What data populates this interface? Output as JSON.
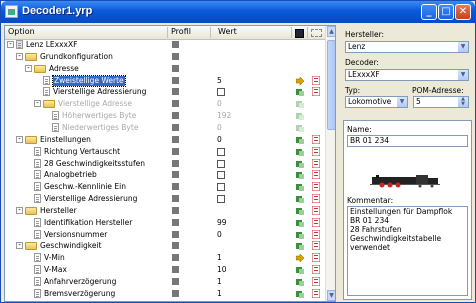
{
  "window": {
    "title": "Decoder1.yrp"
  },
  "grid": {
    "columns": {
      "option": "Option",
      "profil": "Profil",
      "wert": "Wert"
    },
    "rows": [
      {
        "indent": 0,
        "icon": "root",
        "label": "Lenz LExxxXF",
        "profil": true,
        "toggle": "-"
      },
      {
        "indent": 1,
        "icon": "folder",
        "label": "Grundkonfiguration",
        "profil": true,
        "toggle": "-"
      },
      {
        "indent": 2,
        "icon": "folder",
        "label": "Adresse",
        "profil": true,
        "toggle": "-"
      },
      {
        "indent": 3,
        "icon": "doc",
        "label": "Zweistellige Werte",
        "profil": true,
        "value": "5",
        "sel": true,
        "act": "arrow"
      },
      {
        "indent": 3,
        "icon": "doc",
        "label": "Vierstellige Adressierung",
        "profil": true,
        "check": true
      },
      {
        "indent": 3,
        "icon": "folder",
        "label": "Vierstellige Adresse",
        "profil": true,
        "value": "0",
        "dis": true,
        "toggle": "-"
      },
      {
        "indent": 4,
        "icon": "doc",
        "label": "Höherwertiges Byte",
        "profil": true,
        "value": "192",
        "dis": true
      },
      {
        "indent": 4,
        "icon": "doc",
        "label": "Niederwertiges Byte",
        "profil": true,
        "value": "0",
        "dis": true
      },
      {
        "indent": 1,
        "icon": "folder",
        "label": "Einstellungen",
        "profil": true,
        "value": "0",
        "toggle": "-"
      },
      {
        "indent": 2,
        "icon": "doc",
        "label": "Richtung Vertauscht",
        "profil": true,
        "check": true
      },
      {
        "indent": 2,
        "icon": "doc",
        "label": "28 Geschwindigkeitsstufen",
        "profil": true,
        "check": true
      },
      {
        "indent": 2,
        "icon": "doc",
        "label": "Analogbetrieb",
        "profil": true,
        "check": true
      },
      {
        "indent": 2,
        "icon": "doc",
        "label": "Geschw.-Kennlinie Ein",
        "profil": true,
        "check": true
      },
      {
        "indent": 2,
        "icon": "doc",
        "label": "Vierstellige Adressierung",
        "profil": true,
        "check": true
      },
      {
        "indent": 1,
        "icon": "folder",
        "label": "Hersteller",
        "profil": true,
        "toggle": "-"
      },
      {
        "indent": 2,
        "icon": "doc",
        "label": "Identifikation Hersteller",
        "profil": true,
        "value": "99"
      },
      {
        "indent": 2,
        "icon": "doc",
        "label": "Versionsnummer",
        "profil": true,
        "value": "0"
      },
      {
        "indent": 1,
        "icon": "folder",
        "label": "Geschwindigkeit",
        "profil": true,
        "toggle": "-"
      },
      {
        "indent": 2,
        "icon": "doc",
        "label": "V-Min",
        "profil": true,
        "value": "1",
        "act": "arrow"
      },
      {
        "indent": 2,
        "icon": "doc",
        "label": "V-Max",
        "profil": true,
        "value": "10"
      },
      {
        "indent": 2,
        "icon": "doc",
        "label": "Anfahrverzögerung",
        "profil": true,
        "value": "1"
      },
      {
        "indent": 2,
        "icon": "doc",
        "label": "Bremsverzögerung",
        "profil": true,
        "value": "1"
      }
    ]
  },
  "side": {
    "hersteller_label": "Hersteller:",
    "hersteller_value": "Lenz",
    "decoder_label": "Decoder:",
    "decoder_value": "LExxxXF",
    "typ_label": "Typ:",
    "typ_value": "Lokomotive",
    "pom_label": "POM-Adresse:",
    "pom_value": "5",
    "name_label": "Name:",
    "name_value": "BR 01 234",
    "kommentar_label": "Kommentar:",
    "kommentar_lines": [
      "Einstellungen für Dampflok",
      "BR 01 234",
      "28 Fahrstufen",
      "Geschwindigkeitstabelle verwendet"
    ]
  },
  "colors": {
    "titlebar": "#0a5ad8",
    "selection": "#316ac5"
  }
}
